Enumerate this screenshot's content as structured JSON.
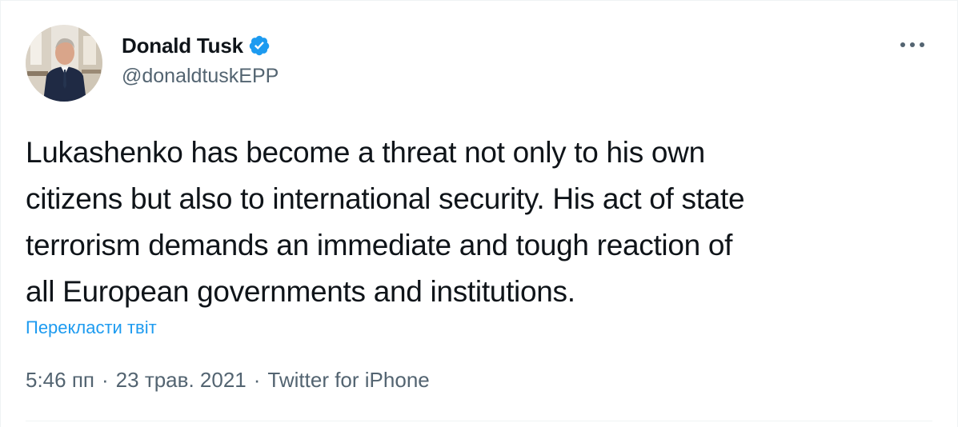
{
  "author": {
    "display_name": "Donald Tusk",
    "handle": "@donaldtuskEPP",
    "verified": true,
    "avatar_icon": "profile-photo"
  },
  "tweet": {
    "text": "Lukashenko has become a threat not only to his own\ncitizens but also to international security. His act of state\nterrorism demands an immediate and tough reaction of\nall European governments and institutions.",
    "translate_label": "Перекласти твіт"
  },
  "meta": {
    "time": "5:46 пп",
    "separator": "·",
    "date": "23 трав. 2021",
    "source": "Twitter for iPhone"
  },
  "icons": {
    "more": "more-horizontal-icon",
    "verified": "verified-badge-icon"
  },
  "colors": {
    "accent": "#1d9bf0",
    "text_primary": "#0f1419",
    "text_secondary": "#536471",
    "border": "#eff3f4"
  }
}
